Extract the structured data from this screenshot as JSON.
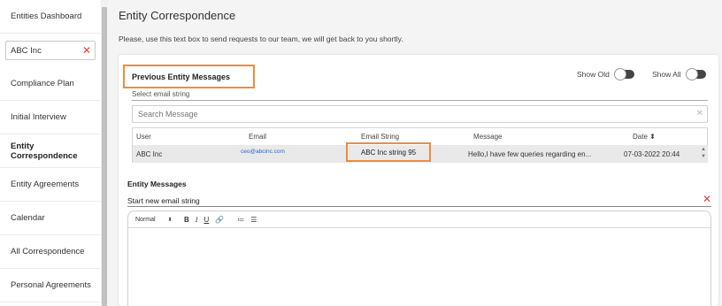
{
  "sidebar": {
    "items": [
      {
        "label": "Entities Dashboard"
      },
      {
        "label": "Compliance Plan"
      },
      {
        "label": "Initial Interview"
      },
      {
        "label": "Entity Correspondence"
      },
      {
        "label": "Entity Agreements"
      },
      {
        "label": "Calendar"
      },
      {
        "label": "All Correspondence"
      },
      {
        "label": "Personal Agreements"
      }
    ],
    "entity_select": {
      "value": "ABC Inc",
      "clear_glyph": "✕"
    }
  },
  "main": {
    "title": "Entity Correspondence",
    "hint": "Please, use this text box to send requests to our team, we will get back to you shortly."
  },
  "previous": {
    "title": "Previous Entity Messages",
    "show_old_label": "Show Old",
    "show_all_label": "Show All",
    "email_string_label": "Select email string",
    "search_placeholder": "Search Message",
    "search_clear_glyph": "✕",
    "columns": [
      "User",
      "Email",
      "Email String",
      "Message",
      "Date ⬍"
    ],
    "rows": [
      {
        "user": "ABC Inc",
        "email": "ceo@abcinc.com",
        "email_string": "ABC Inc string 95",
        "message": "Hello,I have few queries regarding en...",
        "date": "07-03-2022 20:44"
      }
    ]
  },
  "compose": {
    "title": "Entity Messages",
    "new_string_label": "Start new email string",
    "clear_glyph": "✕",
    "toolbar": {
      "format_value": "Normal",
      "bold": "B",
      "italic": "I",
      "underline": "U",
      "link": "🔗",
      "ordered_list": "≔",
      "bullet_list": "☰"
    }
  },
  "colors": {
    "highlight": "#f08c3c",
    "clear_red": "#e0423a",
    "link_blue": "#2b63c8"
  }
}
